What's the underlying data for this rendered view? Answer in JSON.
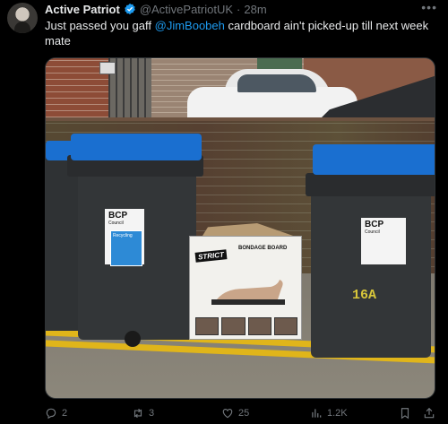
{
  "tweet": {
    "author_name": "Active Patriot",
    "handle": "@ActivePatriotUK",
    "separator": "·",
    "time": "28m",
    "text_before": "Just passed you gaff ",
    "mention": "@JimBoobeh",
    "text_after": " cardboard ain't picked-up till next week mate"
  },
  "media": {
    "bin_left_label": "BCP",
    "bin_left_sublabel": "Council",
    "sticker_text": "Recycling",
    "bin_right_label": "BCP",
    "bin_right_sublabel": "Council",
    "bin_right_number": "16A",
    "box_brand": "STRICT",
    "box_title": "BONDAGE BOARD",
    "colors": {
      "bin_lid": "#1a6fd0",
      "bin_body": "#333638",
      "road_line": "#e0b51a"
    }
  },
  "actions": {
    "replies": "2",
    "reposts": "3",
    "likes": "25",
    "views": "1.2K"
  },
  "icons": [
    "verified-icon",
    "more-icon",
    "reply-icon",
    "repost-icon",
    "like-icon",
    "views-icon",
    "bookmark-icon",
    "share-icon"
  ],
  "colors": {
    "accent": "#1d9bf0",
    "muted": "#71767b",
    "text": "#e7e9ea",
    "background": "#000000"
  }
}
